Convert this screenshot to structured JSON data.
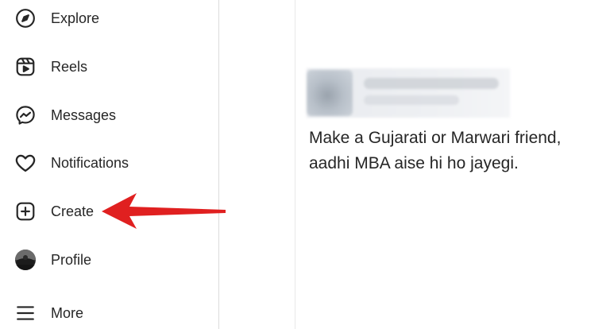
{
  "sidebar": {
    "items": [
      {
        "label": "Explore",
        "icon": "compass-icon"
      },
      {
        "label": "Reels",
        "icon": "reels-icon"
      },
      {
        "label": "Messages",
        "icon": "messenger-icon"
      },
      {
        "label": "Notifications",
        "icon": "heart-icon"
      },
      {
        "label": "Create",
        "icon": "plus-square-icon"
      },
      {
        "label": "Profile",
        "icon": "profile-avatar"
      },
      {
        "label": "More",
        "icon": "hamburger-icon"
      }
    ]
  },
  "post": {
    "lines": [
      "Make a Gujarati or Marwari friend,",
      "aadhi MBA aise hi ho jayegi."
    ]
  },
  "annotation": {
    "color": "#e02020",
    "points_to": "Create"
  }
}
